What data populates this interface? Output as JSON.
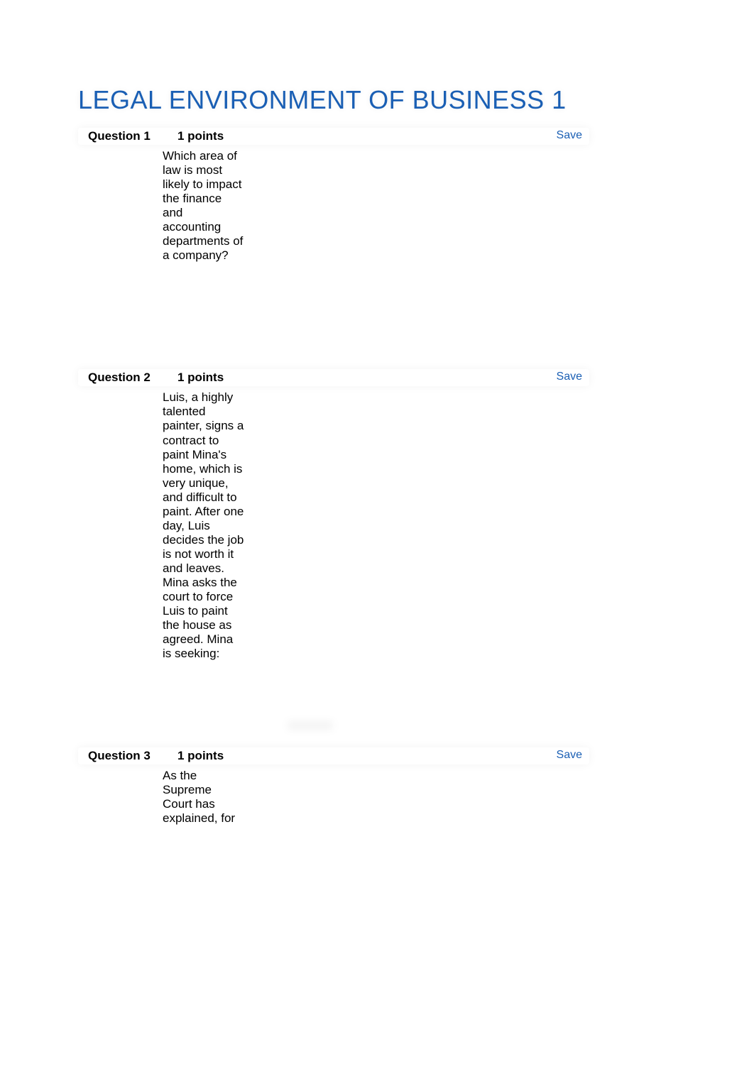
{
  "title": "LEGAL ENVIRONMENT OF BUSINESS 1",
  "questions": [
    {
      "label": "Question 1",
      "points": "1 points",
      "save": "Save",
      "body": "Which area of law is most likely to impact the finance and accounting departments of a company?"
    },
    {
      "label": "Question 2",
      "points": "1 points",
      "save": "Save",
      "body": "Luis, a highly talented painter, signs a contract to paint Mina's home, which is very unique, and difficult to paint. After one day, Luis decides the job is not worth it and leaves. Mina asks the court to force Luis to paint the house as agreed. Mina is seeking:"
    },
    {
      "label": "Question 3",
      "points": "1 points",
      "save": "Save",
      "body": "As the Supreme Court has explained, for"
    }
  ]
}
